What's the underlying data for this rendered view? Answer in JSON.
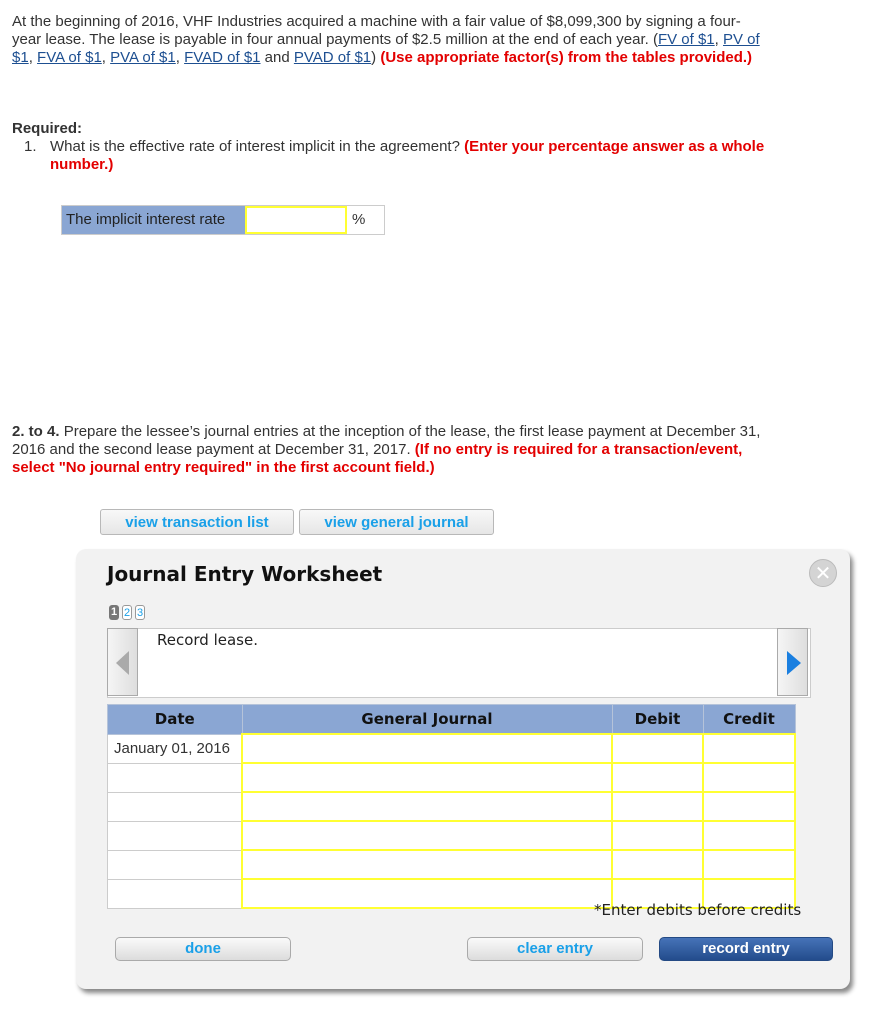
{
  "intro": {
    "text1": "At the beginning of 2016, VHF Industries acquired a machine with a fair value of $8,099,300 by signing a four-year lease. The lease is payable in four annual payments of $2.5 million at the end of each year. (",
    "links": [
      "FV of $1",
      "PV of $1",
      "FVA of $1",
      "PVA of $1",
      "FVAD of $1",
      "PVAD of $1"
    ],
    "sep": ", ",
    "and": " and ",
    "close": ") ",
    "instruction": "(Use appropriate factor(s) from the tables provided.)"
  },
  "required": {
    "title": "Required:",
    "q1_num": "1.",
    "q1_text": "What is the effective rate of interest implicit in the agreement? ",
    "q1_instruction": "(Enter your percentage answer as a whole number.)",
    "rate_label": "The implicit interest rate",
    "rate_value": "",
    "rate_unit": "%",
    "q2_num": "2. to 4.",
    "q2_text": "Prepare the lessee’s journal entries at the inception of the lease, the first lease payment at December 31, 2016 and the second lease payment at December 31, 2017. ",
    "q2_instruction": "(If no entry is required for a transaction/event, select \"No journal entry required\" in the first account field.)"
  },
  "buttons": {
    "view_transaction_list": "view transaction list",
    "view_general_journal": "view general journal"
  },
  "worksheet": {
    "title": "Journal Entry Worksheet",
    "close_icon": "✕",
    "pages": [
      "1",
      "2",
      "3"
    ],
    "active_page": 1,
    "description": "Record lease.",
    "columns": [
      "Date",
      "General Journal",
      "Debit",
      "Credit"
    ],
    "rows": [
      {
        "date": "January 01, 2016",
        "account": "",
        "debit": "",
        "credit": ""
      },
      {
        "date": "",
        "account": "",
        "debit": "",
        "credit": ""
      },
      {
        "date": "",
        "account": "",
        "debit": "",
        "credit": ""
      },
      {
        "date": "",
        "account": "",
        "debit": "",
        "credit": ""
      },
      {
        "date": "",
        "account": "",
        "debit": "",
        "credit": ""
      },
      {
        "date": "",
        "account": "",
        "debit": "",
        "credit": ""
      }
    ],
    "note": "*Enter debits before credits",
    "done": "done",
    "clear_entry": "clear entry",
    "record_entry": "record entry"
  }
}
